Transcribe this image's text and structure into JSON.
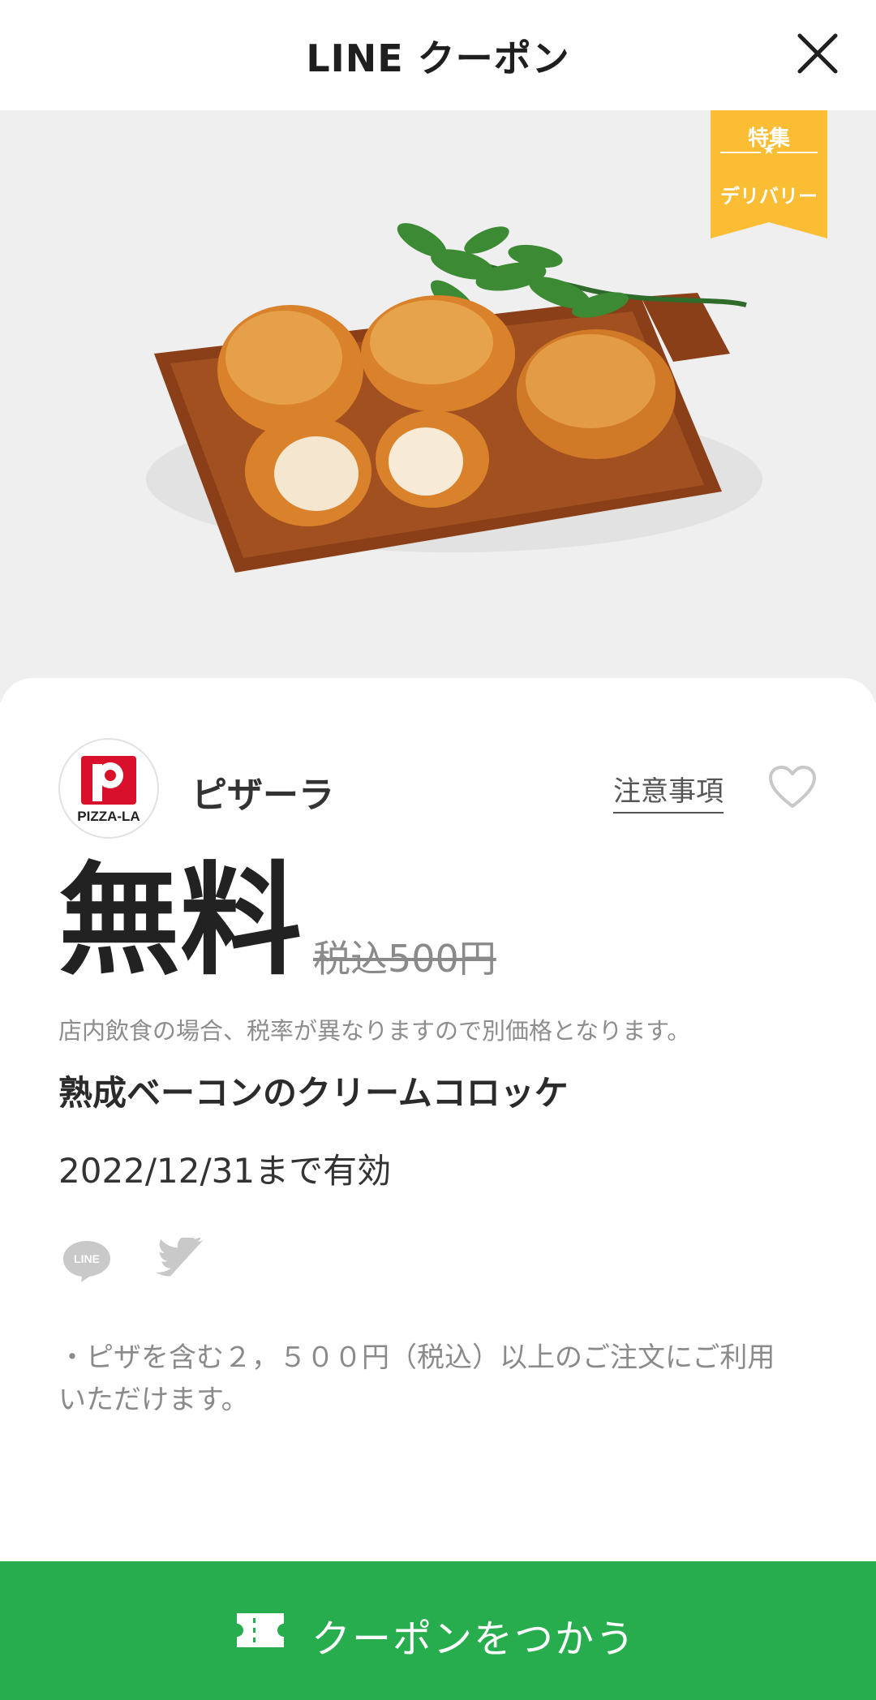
{
  "header": {
    "title": "LINE クーポン"
  },
  "hero": {
    "badge": {
      "top": "特集",
      "star": "★",
      "bottom": "デリバリー"
    }
  },
  "shop": {
    "name": "ピザーラ",
    "logo_text": "PIZZA-LA",
    "notes_label": "注意事項"
  },
  "offer": {
    "price": "無料",
    "original_price": "税込500円",
    "tax_note": "店内飲食の場合、税率が異なりますので別価格となります。",
    "product_name": "熟成ベーコンのクリームコロッケ",
    "validity": "2022/12/31まで有効",
    "condition_line1": "・ピザを含む２，５００円（税込）以上のご注文にご利用",
    "condition_line2": "いただけます。"
  },
  "share": {
    "line_label": "LINE"
  },
  "footer": {
    "use_button_label": "クーポンをつかう"
  },
  "icons": {
    "close": "close-icon",
    "favorite": "heart-icon",
    "line_share": "line-icon",
    "twitter_share": "twitter-icon",
    "ticket": "ticket-icon"
  },
  "colors": {
    "accent_green": "#28ad4e",
    "badge_yellow": "#fbbd33",
    "hero_bg": "#efefef"
  }
}
